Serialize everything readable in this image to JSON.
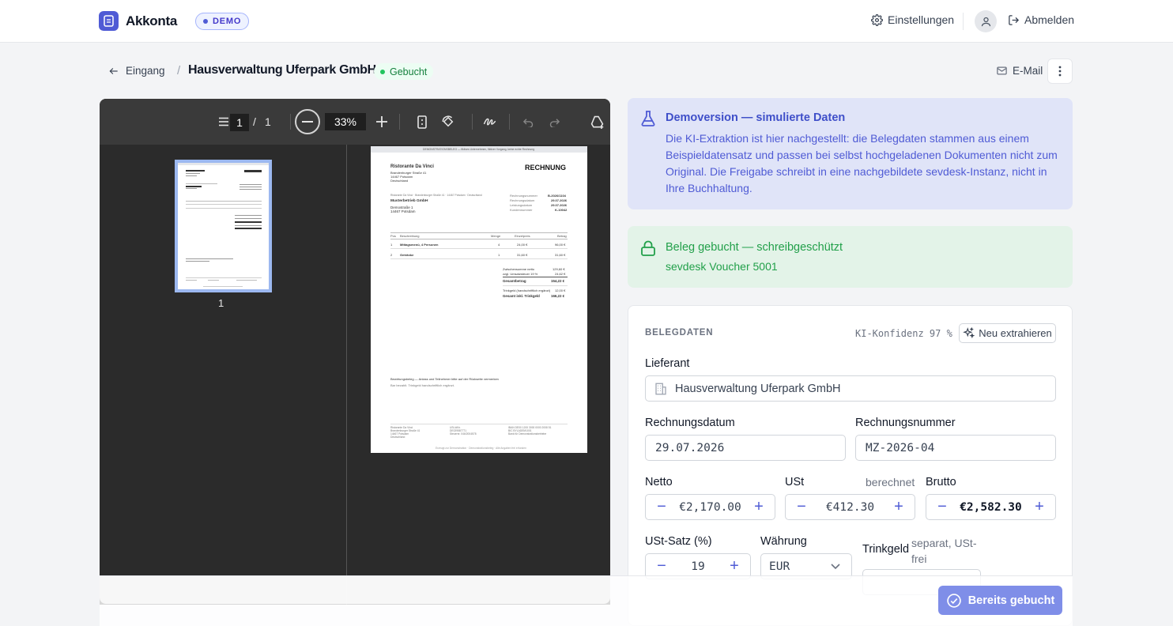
{
  "app": {
    "name": "Akkonta",
    "badge": "DEMO"
  },
  "topbar": {
    "settings_label": "Einstellungen",
    "logout_label": "Abmelden"
  },
  "breadcrumb": {
    "back_label": "Eingang",
    "separator": "/",
    "title": "Hausverwaltung Uferpark GmbH",
    "status": "Gebucht"
  },
  "actions": {
    "email_label": "E-Mail"
  },
  "viewer": {
    "page_current": "1",
    "page_separator": "/",
    "page_total": "1",
    "zoom": "33%",
    "thumb_label": "1"
  },
  "document": {
    "banner": "DEMONSTRATIONSBELEG — fiktives Unternehmen, fiktiver Vorgang, keine echte Rechnung",
    "vendor_name": "Ristorante Da Vinci",
    "vendor_addr1": "Brandenburger Straße 41",
    "vendor_addr2": "14467 Potsdam",
    "vendor_addr3": "Deutschland",
    "doc_type": "RECHNUNG",
    "sender_line": "Ristorante Da Vinci · Brandenburger Straße 41 · 14467 Potsdam · Deutschland",
    "recipient_name": "Musterbetrieb GmbH",
    "recipient_addr1": "Demostraße 1",
    "recipient_addr2": "14467 Potsdam",
    "meta": [
      {
        "k": "Rechnungsnummer",
        "v": "B-2026/1104"
      },
      {
        "k": "Rechnungsdatum",
        "v": "29.07.2026"
      },
      {
        "k": "Leistungsdatum",
        "v": "29.07.2026"
      },
      {
        "k": "Kundennummer",
        "v": "K-10042"
      }
    ],
    "cols": {
      "pos": "Pos",
      "desc": "Beschreibung",
      "qty": "Menge",
      "unit": "Einzelpreis",
      "amount": "Betrag"
    },
    "rows": [
      {
        "pos": "1",
        "desc": "Mittagsmenü, 4 Personen",
        "qty": "4",
        "unit": "24,00 €",
        "amount": "96,00 €"
      },
      {
        "pos": "2",
        "desc": "Getränke",
        "qty": "1",
        "unit": "31,60 €",
        "amount": "31,60 €"
      }
    ],
    "totals": [
      {
        "k": "Zwischensumme netto",
        "v": "129,60 €",
        "bold": false
      },
      {
        "k": "zzgl. Umsatzsteuer 19 %",
        "v": "24,62 €",
        "bold": false
      },
      {
        "k": "Gesamtbetrag",
        "v": "154,22 €",
        "bold": true
      },
      {
        "k": "Trinkgeld (handschriftlich ergänzt)",
        "v": "12,00 €",
        "bold": false
      },
      {
        "k": "Gesamt inkl. Trinkgeld",
        "v": "166,22 €",
        "bold": true
      }
    ],
    "note1": "Bewirtungsbeleg — Anlass und Teilnehmer bitte auf der Rückseite vermerken",
    "note2": "Bar bezahlt. Trinkgeld handschriftlich ergänzt.",
    "foot_col1": [
      "Ristorante Da Vinci",
      "Brandenburger Straße 41",
      "14467 Potsdam",
      "Deutschland"
    ],
    "foot_col2": [
      "USt-IdNr.",
      "DE029587771",
      "Steuernr. 046/2004578"
    ],
    "foot_col3": [
      "IBAN DE00 1200 3000 0000 2008 51",
      "BIC BYLADEM1001",
      "Bank für Demonstrationsbetriebe"
    ],
    "foot_note": "Erzeugt zur Demonstration · Demonstrationsbeleg · Alle Angaben frei erfunden"
  },
  "demo_notice": {
    "title": "Demoversion — simulierte Daten",
    "text": "Die KI-Extraktion ist hier nachgestellt: die Belegdaten stammen aus einem Beispieldatensatz und passen bei selbst hochgeladenen Dokumenten nicht zum Original. Die Freigabe schreibt in eine nachgebildete sevdesk-Instanz, nicht in Ihre Buchhaltung."
  },
  "booked_notice": {
    "title": "Beleg gebucht — schreibgeschützt",
    "sub": "sevdesk Voucher 5001"
  },
  "form": {
    "section": "BELEGDATEN",
    "confidence": "KI-Konfidenz 97 %",
    "reextract_label": "Neu extrahieren",
    "supplier_label": "Lieferant",
    "supplier_value": "Hausverwaltung Uferpark GmbH",
    "date_label": "Rechnungsdatum",
    "date_value": "29.07.2026",
    "number_label": "Rechnungsnummer",
    "number_value": "MZ-2026-04",
    "net_label": "Netto",
    "net_value": "€2,170.00",
    "vat_label": "USt",
    "vat_hint": "berechnet",
    "vat_value": "€412.30",
    "gross_label": "Brutto",
    "gross_value": "€2,582.30",
    "rate_label": "USt-Satz (%)",
    "rate_value": "19",
    "currency_label": "Währung",
    "currency_value": "EUR",
    "tip_label": "Trinkgeld",
    "tip_hint": "separat, USt-frei"
  },
  "footer": {
    "booked_button": "Bereits gebucht"
  },
  "colors": {
    "accent": "#4f5bd5",
    "success": "#22a04a",
    "demo_bg": "#e0e4f8",
    "success_bg": "#e3f3e8"
  }
}
